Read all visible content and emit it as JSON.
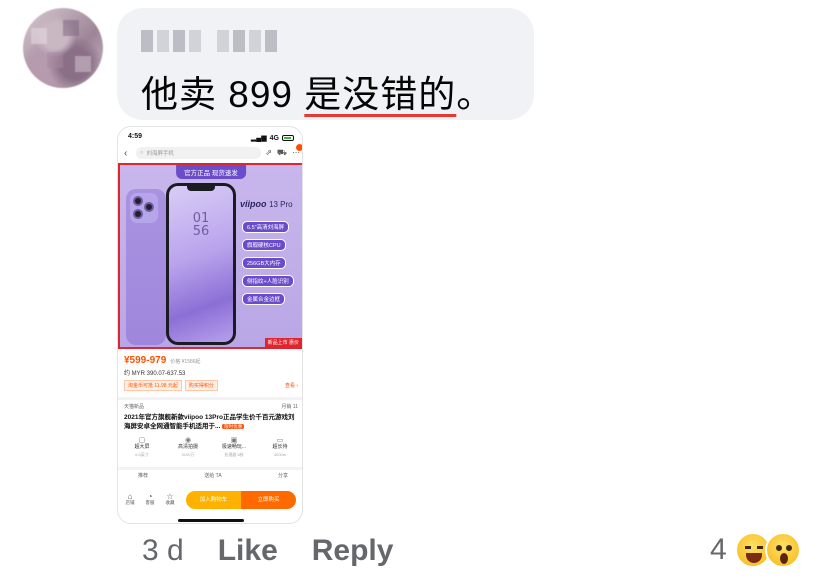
{
  "comment": {
    "author_name_blurred": "",
    "text_plain": "他卖 899 ",
    "text_underlined": "是没错的",
    "text_end": "。"
  },
  "screenshot": {
    "status_time": "4:59",
    "status_network": "4G",
    "search_placeholder": "刘海屏手机",
    "banner": "官方正品 现货速发",
    "brand": "viipoo",
    "model": "13 Pro",
    "clock_hour": "01",
    "clock_min": "56",
    "features": [
      "6.5\"高清刘海屏",
      "旗舰硬核CPU",
      "256GB大内存",
      "侧指纹+人脸识别",
      "金属合金边框"
    ],
    "new_tag": "新品上市 惠价",
    "price": "¥599-979",
    "orig_price": "价格 ¥1586起",
    "myr": "约 MYR 390.07-637.53",
    "coupons": [
      "淘金币可抵 11.98 元起",
      "购买得积分"
    ],
    "more": "查看 ›",
    "shop": "天猫新品",
    "shop_right": "月销 11",
    "title": "2021年官方旗舰新款viipoo 13Pro正品学生价千百元游戏刘海屏安卓全网通智能手机适用于...",
    "title_tag": "限时优惠",
    "specs": [
      {
        "label": "超大屏",
        "sub": "6.5英寸"
      },
      {
        "label": "高清拍摄",
        "sub": "3100万"
      },
      {
        "label": "极速畅玩...",
        "sub": "处理器 8核"
      },
      {
        "label": "超长待",
        "sub": "4000m"
      }
    ],
    "rec_left": "推荐",
    "rec_mid": "送给 TA",
    "rec_right": "分享",
    "bottom_icons": [
      "店铺",
      "客服",
      "收藏"
    ],
    "btn_cart": "加入购物车",
    "btn_buy": "立即购买"
  },
  "actions": {
    "time": "3 d",
    "like": "Like",
    "reply": "Reply",
    "reaction_count": "4"
  },
  "icons": {
    "emoji_1": "laughing-emoji-icon",
    "emoji_2": "wow-emoji-icon"
  }
}
